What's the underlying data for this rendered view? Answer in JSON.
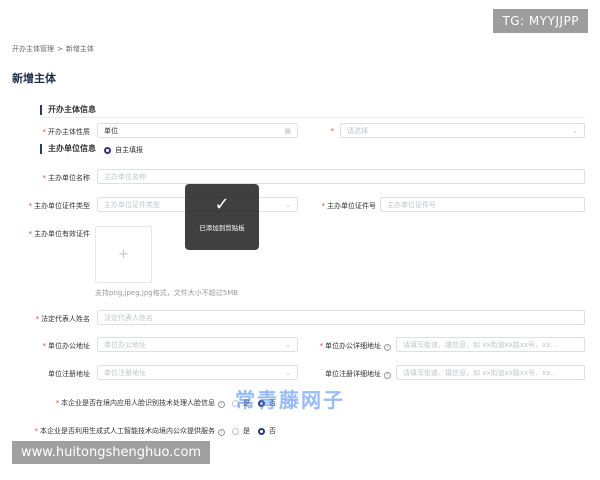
{
  "breadcrumb": {
    "parent": "开办主体管理",
    "sep": ">",
    "current": "新增主体"
  },
  "page_title": "新增主体",
  "section_info": "开办主体信息",
  "section_unit": "主办单位信息",
  "self_fill_label": "自主填报",
  "fields": {
    "nature_label": "开办主体性质",
    "nature_value": "单位",
    "unlabeled_placeholder": "请选择",
    "unit_name_label": "主办单位名称",
    "unit_name_ph": "主办单位名称",
    "cert_type_label": "主办单位证件类型",
    "cert_type_ph": "主办单位证件类型",
    "cert_no_label": "主办单位证件号",
    "cert_no_ph": "主办单位证件号",
    "valid_cert_label": "主办单位有效证件",
    "upload_hint": "支持png,jpeg,jpg格式，文件大小不超过5MB",
    "legal_rep_label": "法定代表人姓名",
    "legal_rep_ph": "法定代表人姓名",
    "office_addr_label": "单位办公地址",
    "office_addr_ph": "单位办公地址",
    "office_detail_label": "单位办公详细地址",
    "office_detail_ph": "请填写街道、镇信息，如 xx街道xx路xx号、xx...",
    "reg_addr_label": "单位注册地址",
    "reg_addr_ph": "单位注册地址",
    "reg_detail_label": "单位注册详细地址",
    "reg_detail_ph": "请填写街道、镇信息，如 xx街道xx路xx号、xx..."
  },
  "q1": {
    "label": "本企业是否在境内应用人脸识别技术处理人脸信息",
    "yes": "是",
    "no": "否"
  },
  "q2": {
    "label": "本企业是否利用生成式人工智能技术向境内公众提供服务",
    "yes": "是",
    "no": "否"
  },
  "toast": {
    "icon": "check-icon",
    "text": "已添加到剪贴板"
  },
  "overlay": {
    "top_tag": "TG: MYYJJPP",
    "bottom_tag": "www.huitongshenghuo.com",
    "watermark": "常青藤网子"
  },
  "colors": {
    "accent": "#2b3a67",
    "required": "#e0453a"
  }
}
